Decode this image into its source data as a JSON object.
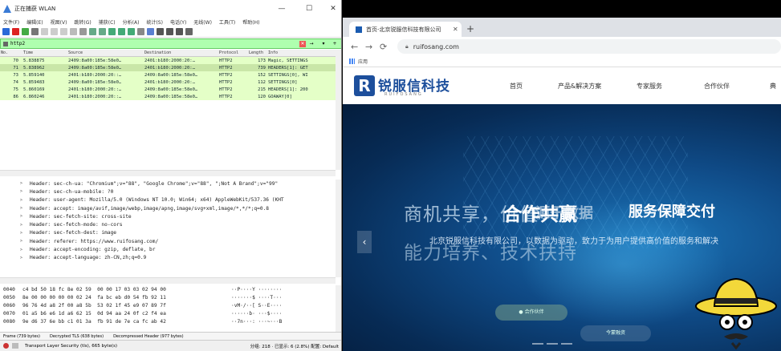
{
  "wireshark": {
    "title": "正在捕获 WLAN",
    "menu": [
      "文件(F)",
      "编辑(E)",
      "视图(V)",
      "跳转(G)",
      "捕获(C)",
      "分析(A)",
      "统计(S)",
      "电话(Y)",
      "无线(W)",
      "工具(T)",
      "帮助(H)"
    ],
    "filter": "http2",
    "columns": {
      "no": "No.",
      "time": "Time",
      "source": "Source",
      "destination": "Destination",
      "protocol": "Protocol",
      "length": "Length",
      "info": "Info"
    },
    "packets": [
      {
        "no": "70",
        "time": "5.838875",
        "source": "2409:8a00:185e:58e0…",
        "destination": "2401:b180:2000:20:…",
        "protocol": "HTTP2",
        "length": "173",
        "info": "Magic, SETTINGS"
      },
      {
        "no": "71",
        "time": "5.838962",
        "source": "2409:8a00:185e:58e0…",
        "destination": "2401:b180:2000:20:…",
        "protocol": "HTTP2",
        "length": "739",
        "info": "HEADERS[1]: GET"
      },
      {
        "no": "73",
        "time": "5.859140",
        "source": "2401:b180:2000:20::…",
        "destination": "2409:8a00:185e:58e0…",
        "protocol": "HTTP2",
        "length": "152",
        "info": "SETTINGS[0], WI"
      },
      {
        "no": "74",
        "time": "5.859483",
        "source": "2409:8a00:185e:58e0…",
        "destination": "2401:b180:2000:20:…",
        "protocol": "HTTP2",
        "length": "112",
        "info": "SETTINGS[0]"
      },
      {
        "no": "75",
        "time": "5.860169",
        "source": "2401:b180:2000:20::…",
        "destination": "2409:8a00:185e:58e0…",
        "protocol": "HTTP2",
        "length": "215",
        "info": "HEADERS[1]: 200"
      },
      {
        "no": "86",
        "time": "6.860246",
        "source": "2401:b180:2000:20::…",
        "destination": "2409:8a00:185e:58e0…",
        "protocol": "HTTP2",
        "length": "120",
        "info": "GOAWAY[0]"
      }
    ],
    "details": [
      "Header: sec-ch-ua: \"Chromium\";v=\"88\", \"Google Chrome\";v=\"88\", \";Not A Brand\";v=\"99\"",
      "Header: sec-ch-ua-mobile: ?0",
      "Header: user-agent: Mozilla/5.0 (Windows NT 10.0; Win64; x64) AppleWebKit/537.36 (KHT",
      "Header: accept: image/avif,image/webp,image/apng,image/svg+xml,image/*,*/*;q=0.8",
      "Header: sec-fetch-site: cross-site",
      "Header: sec-fetch-mode: no-cors",
      "Header: sec-fetch-dest: image",
      "Header: referer: https://www.ruifosang.com/",
      "Header: accept-encoding: gzip, deflate, br",
      "Header: accept-language: zh-CN,zh;q=0.9"
    ],
    "hex": [
      {
        "off": "0040",
        "bytes": "c4 bd 50 18 fc 8e 02 59  00 00 17 03 03 02 94 00",
        "ascii": "··P····Y ········"
      },
      {
        "off": "0050",
        "bytes": "8e 00 00 00 00 00 02 24  fa bc eb d0 54 fb 92 11",
        "ascii": "·······$ ····T···"
      },
      {
        "off": "0060",
        "bytes": "96 76 4d a8 2f 00 a8 5b  53 02 1f 45 e9 07 89 7f",
        "ascii": "·vM·/··[ S··E····"
      },
      {
        "off": "0070",
        "bytes": "01 a5 b6 e6 1d a6 62 15  0d 94 aa 24 0f c2 f4 ea",
        "ascii": "······b· ···$····"
      },
      {
        "off": "0080",
        "bytes": "9e d6 37 6e bb c1 01 3a  fb 91 de 7e ca fc ab 42",
        "ascii": "··7n···: ···~···B"
      }
    ],
    "bottom_tabs": [
      "Frame (739 bytes)",
      "Decrypted TLS (638 bytes)",
      "Decompressed Header (977 bytes)"
    ],
    "status_left": "Transport Layer Security (tls), 665 byte(s)",
    "status_right": "分组: 218 · 已显示: 6 (2.8%)   配置: Default"
  },
  "chrome": {
    "tab_title": "首页-北京锐服信科技有限公司",
    "url": "ruifosang.com",
    "bookmark": "应用"
  },
  "site": {
    "logo_cn": "锐服信科技",
    "logo_en": "RUIFOSANG",
    "nav": [
      "首页",
      "产品&解决方案",
      "专家服务",
      "合作伙伴",
      "典"
    ],
    "hero_line1": "商机共享，价值",
    "hero_line1_bold": "合作共赢",
    "hero_line1_extra": "服务保障交付",
    "hero_overlay": "源于数据",
    "hero_sub": "北京锐服信科技有限公司，以数据为驱动，致力于为用户提供高价值的服务和解决",
    "hero_line2": "能力培养、技术扶持",
    "btn1": "● 合作伙伴",
    "btn2": "今蒙融资"
  }
}
